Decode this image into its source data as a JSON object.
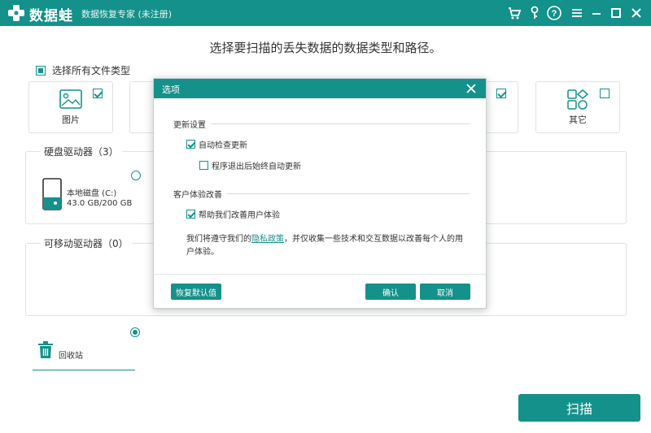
{
  "titlebar": {
    "logo_text": "数据蛙",
    "app_subtitle": "数据恢复专家 (未注册)",
    "icons": [
      "cart-icon",
      "key-icon",
      "help-icon",
      "menu-icon",
      "minimize-icon",
      "maximize-icon",
      "close-icon"
    ]
  },
  "main": {
    "title": "选择要扫描的丢失数据的数据类型和路径。",
    "select_all_label": "选择所有文件类型",
    "cards": [
      {
        "label": "图片",
        "checked": true
      },
      {
        "label": "其它",
        "checked": false
      }
    ],
    "hard_drives": {
      "title": "硬盘驱动器（3）",
      "drive_name": "本地磁盘 (C:)",
      "drive_size": "43.0 GB/200 GB"
    },
    "removable": {
      "title": "可移动驱动器（0）"
    },
    "recycle_label": "回收站",
    "scan_button": "扫描"
  },
  "dialog": {
    "title": "选项",
    "update_group": "更新设置",
    "auto_check_update": "自动检查更新",
    "always_update_on_exit": "程序退出后始终自动更新",
    "ux_group": "客户体验改善",
    "help_improve": "帮助我们改善用户体验",
    "privacy_prefix": "我们将遵守我们的",
    "privacy_link": "隐私政策",
    "privacy_suffix": "，并仅收集一些技术和交互数据以改善每个人的用户体验。",
    "restore_default": "恢复默认值",
    "confirm": "确认",
    "cancel": "取消"
  },
  "colors": {
    "accent": "#14918a"
  }
}
